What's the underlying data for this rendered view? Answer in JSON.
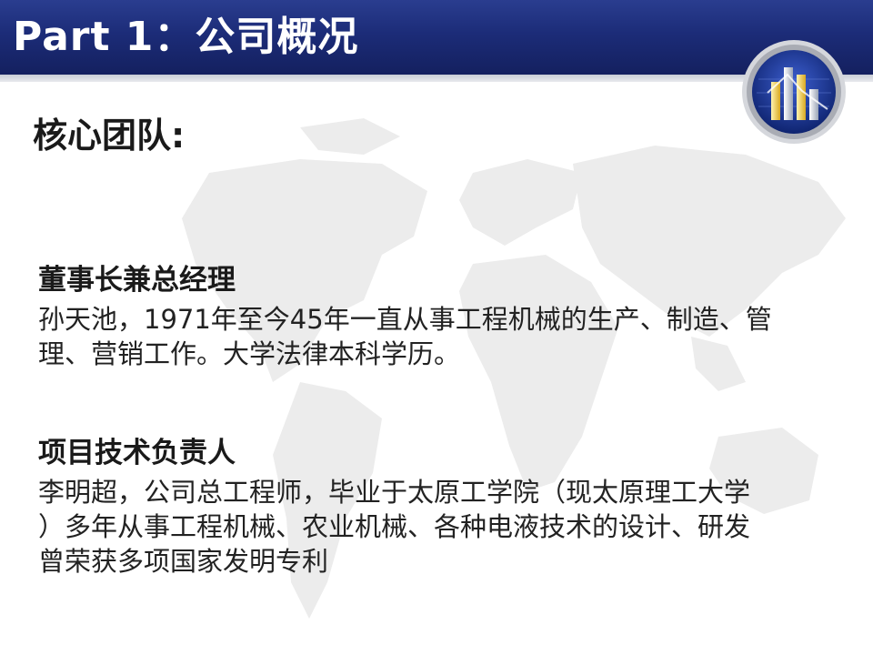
{
  "slide": {
    "title": "Part 1：公司概况",
    "section_heading": "核心团队:"
  },
  "team": [
    {
      "role": "董事长兼总经理",
      "bio_lines": [
        "孙天池，1971年至今45年一直从事工程机械的生产、制造、管",
        "理、营销工作。大学法律本科学历。"
      ]
    },
    {
      "role": "项目技术负责人",
      "bio_lines": [
        "李明超，公司总工程师，毕业于太原工学院（现太原理工大学",
        "）多年从事工程机械、农业机械、各种电液技术的设计、研发",
        "曾荣获多项国家发明专利"
      ]
    }
  ],
  "colors": {
    "header": "#1c2c78",
    "text": "#1a1a1a",
    "map": "#ececec",
    "badge_ring": "#a9acb4",
    "badge_fill": "#1e3a9a"
  },
  "icons": {
    "background": "world-map-watermark",
    "badge": "bar-chart-badge-icon"
  }
}
